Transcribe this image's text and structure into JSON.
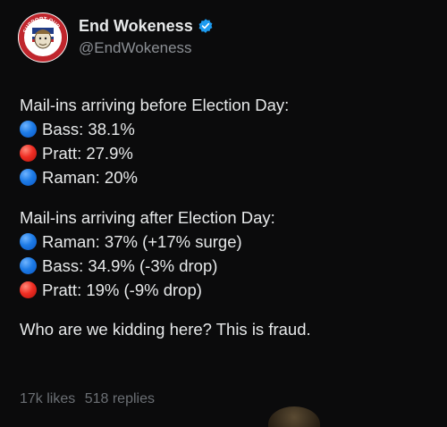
{
  "post": {
    "display_name": "End Wokeness",
    "handle": "@EndWokeness",
    "verified_icon": "verified-badge-icon",
    "avatar_icon": "profile-avatar",
    "avatar_text_top": "SUPPORT OUR",
    "avatar_text_bottom": "FARMER FRIENDS",
    "sections": [
      {
        "heading": "Mail-ins arriving before Election Day:",
        "items": [
          {
            "dot": "blue",
            "text": "Bass: 38.1%"
          },
          {
            "dot": "red",
            "text": "Pratt: 27.9%"
          },
          {
            "dot": "blue",
            "text": "Raman: 20%"
          }
        ]
      },
      {
        "heading": "Mail-ins arriving after Election Day:",
        "items": [
          {
            "dot": "blue",
            "text": "Raman: 37% (+17% surge)"
          },
          {
            "dot": "blue",
            "text": "Bass: 34.9% (-3% drop)"
          },
          {
            "dot": "red",
            "text": "Pratt: 19% (-9% drop)"
          }
        ]
      }
    ],
    "closing": "Who are we kidding here? This is fraud.",
    "likes": "17k likes",
    "replies": "518 replies"
  },
  "colors": {
    "background": "#0b0b0c",
    "text": "#e7e9ea",
    "muted": "#8b8f94",
    "verified": "#1d9bf0",
    "blue_dot": "#1d7be6",
    "red_dot": "#ef2e24"
  }
}
